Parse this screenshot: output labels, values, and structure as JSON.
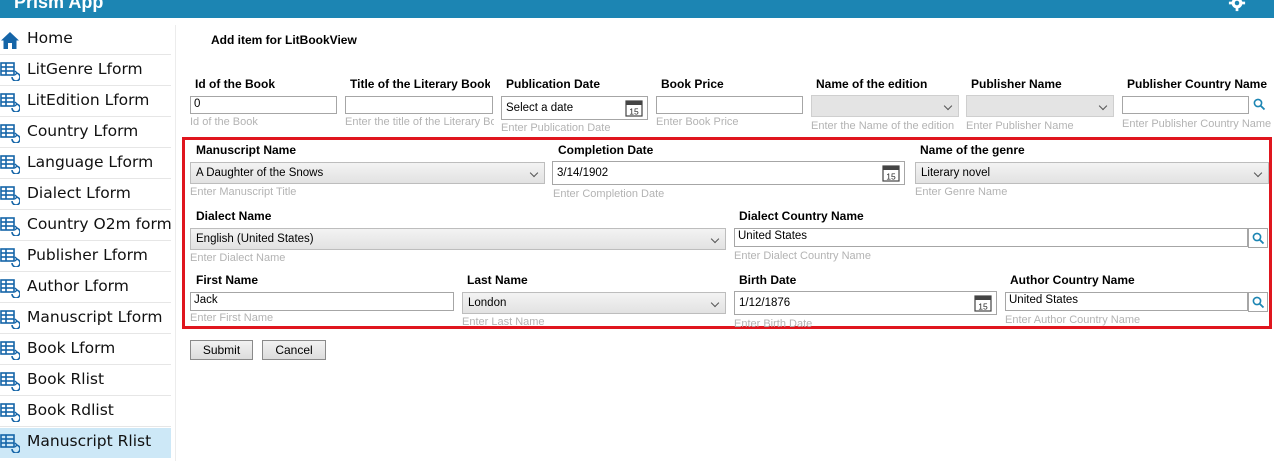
{
  "app": {
    "title": "Prism App"
  },
  "sidebar": {
    "items": [
      {
        "label": "Home",
        "icon": "home-icon"
      },
      {
        "label": "LitGenre Lform",
        "icon": "form-icon"
      },
      {
        "label": "LitEdition Lform",
        "icon": "form-icon"
      },
      {
        "label": "Country Lform",
        "icon": "form-icon"
      },
      {
        "label": "Language Lform",
        "icon": "form-icon"
      },
      {
        "label": "Dialect Lform",
        "icon": "form-icon"
      },
      {
        "label": "Country O2m form",
        "icon": "form-icon"
      },
      {
        "label": "Publisher Lform",
        "icon": "form-icon"
      },
      {
        "label": "Author Lform",
        "icon": "form-icon"
      },
      {
        "label": "Manuscript Lform",
        "icon": "form-icon"
      },
      {
        "label": "Book Lform",
        "icon": "form-icon"
      },
      {
        "label": "Book Rlist",
        "icon": "form-icon"
      },
      {
        "label": "Book Rdlist",
        "icon": "form-icon"
      },
      {
        "label": "Manuscript Rlist",
        "icon": "form-icon",
        "selected": true
      }
    ]
  },
  "form": {
    "title": "Add item for LitBookView",
    "book_id": {
      "label": "Id of the Book",
      "value": "0",
      "hint": "Id of the Book"
    },
    "book_title": {
      "label": "Title of the Literary Book",
      "value": "",
      "hint": "Enter the title of the Literary Book"
    },
    "pub_date": {
      "label": "Publication Date",
      "value": "Select a date",
      "hint": "Enter Publication Date"
    },
    "price": {
      "label": "Book Price",
      "value": "",
      "hint": "Enter Book Price"
    },
    "edition": {
      "label": "Name of the edition",
      "value": "",
      "hint": "Enter the Name of the edition"
    },
    "publisher": {
      "label": "Publisher Name",
      "value": "",
      "hint": "Enter Publisher Name"
    },
    "pub_country": {
      "label": "Publisher Country Name",
      "value": "",
      "hint": "Enter Publisher Country Name"
    },
    "manuscript": {
      "label": "Manuscript Name",
      "value": "A Daughter of the Snows",
      "hint": "Enter Manuscript Title"
    },
    "completion": {
      "label": "Completion Date",
      "value": "3/14/1902",
      "hint": "Enter Completion Date"
    },
    "genre": {
      "label": "Name of the genre",
      "value": "Literary novel",
      "hint": "Enter Genre Name"
    },
    "dialect": {
      "label": "Dialect Name",
      "value": "English (United States)",
      "hint": "Enter Dialect Name"
    },
    "dialect_country": {
      "label": "Dialect Country Name",
      "value": "United States",
      "hint": "Enter Dialect Country Name"
    },
    "first_name": {
      "label": "First Name",
      "value": "Jack",
      "hint": "Enter First Name"
    },
    "last_name": {
      "label": "Last Name",
      "value": "London",
      "hint": "Enter Last Name"
    },
    "birth_date": {
      "label": "Birth Date",
      "value": "1/12/1876",
      "hint": "Enter Birth Date"
    },
    "author_country": {
      "label": "Author Country Name",
      "value": "United States",
      "hint": "Enter Author Country Name"
    },
    "calendar_day": "15"
  },
  "buttons": {
    "submit": "Submit",
    "cancel": "Cancel"
  },
  "colors": {
    "titlebar": "#1c85b3",
    "highlight": "#e0161e",
    "selected": "#cde8f7",
    "icon": "#1565a8"
  }
}
